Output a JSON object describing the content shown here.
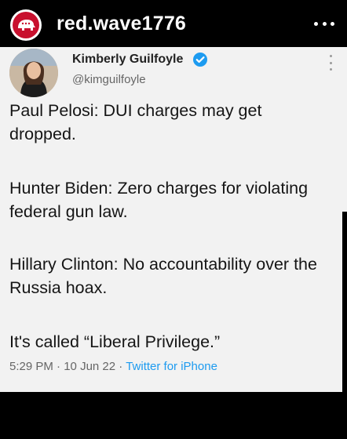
{
  "header": {
    "username": "red.wave1776",
    "avatar_icon": "elephant-logo-icon",
    "more_icon": "more-horizontal-icon"
  },
  "tweet": {
    "display_name": "Kimberly Guilfoyle",
    "handle": "@kimguilfoyle",
    "verified": true,
    "paragraphs": [
      "Paul Pelosi: DUI charges may get dropped.",
      "Hunter Biden: Zero charges for violating federal gun law.",
      "Hillary Clinton: No accountability over the Russia hoax.",
      "It's called “Liberal Privilege.”"
    ],
    "time": "5:29 PM",
    "date": "10 Jun 22",
    "source": "Twitter for iPhone",
    "separator": "·"
  },
  "colors": {
    "accent": "#1d9bf0",
    "brand_red": "#c8102e",
    "card_bg": "#f2f2f2"
  }
}
